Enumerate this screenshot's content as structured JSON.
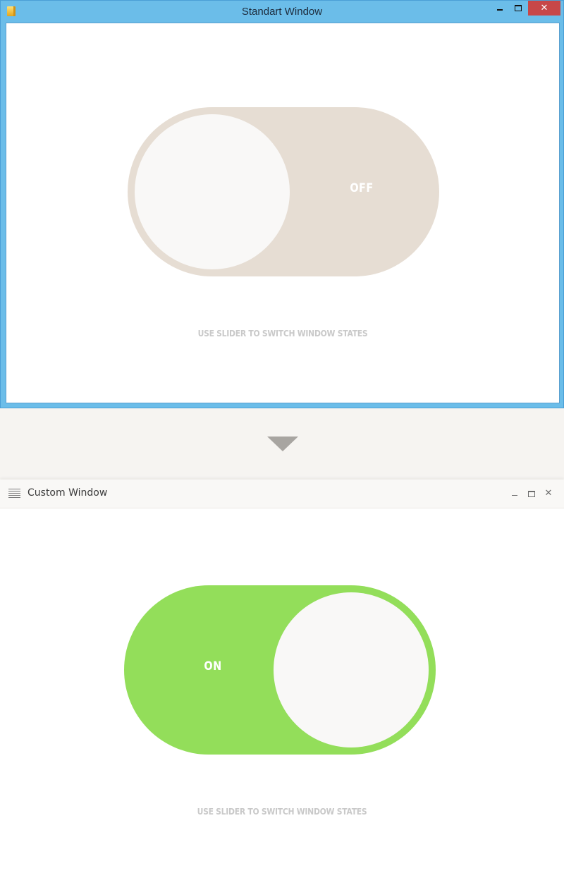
{
  "standard_window": {
    "title": "Standart Window",
    "app_icon": "folder-icon",
    "controls": {
      "minimize_icon": "minimize-icon",
      "maximize_icon": "maximize-icon",
      "close_glyph": "✕"
    },
    "toggle": {
      "state_label": "OFF",
      "is_on": false,
      "track_color": "#e6ddd3",
      "knob_color": "#f9f8f7"
    },
    "hint": "USE SLIDER TO SWITCH WINDOW STATES"
  },
  "separator": {
    "icon": "triangle-down-icon"
  },
  "custom_window": {
    "title": "Custom Window",
    "menu_icon": "hamburger-menu-icon",
    "controls": {
      "minimize_icon": "minimize-icon",
      "maximize_icon": "maximize-icon",
      "close_glyph": "✕"
    },
    "toggle": {
      "state_label": "ON",
      "is_on": true,
      "track_color": "#93de5a",
      "knob_color": "#f9f8f7"
    },
    "hint": "USE SLIDER TO SWITCH WINDOW STATES"
  },
  "colors": {
    "window_frame": "#6bbde9",
    "close_button": "#c74748",
    "page_background": "#f6f4f1",
    "hint_text": "#c9c9c9"
  }
}
